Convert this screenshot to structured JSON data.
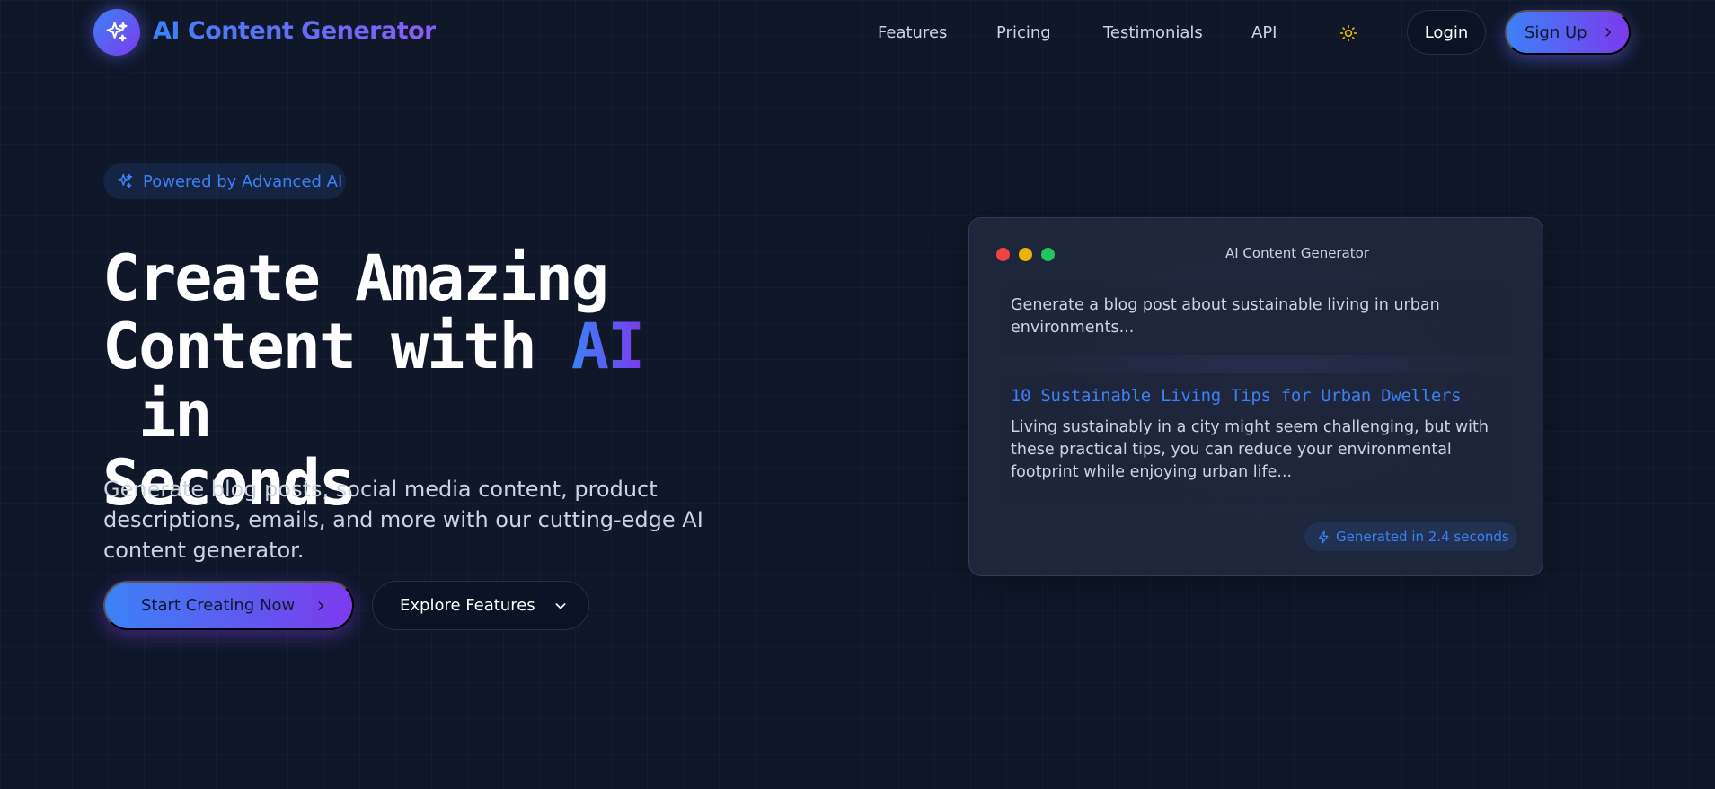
{
  "header": {
    "logo_text": "AI Content Generator",
    "nav": [
      "Features",
      "Pricing",
      "Testimonials",
      "API"
    ],
    "login_label": "Login",
    "signup_label": "Sign Up"
  },
  "hero": {
    "badge": "Powered by Advanced AI",
    "title_line1": "Create Amazing",
    "title_line2_pre": "Content with ",
    "title_accent": "AI",
    "title_line2_post": " in",
    "title_line3": "Seconds",
    "subtitle": "Generate blog posts, social media content, product descriptions, emails, and more with our cutting-edge AI content generator.",
    "cta_primary": "Start Creating Now",
    "cta_secondary": "Explore Features"
  },
  "preview": {
    "window_title": "AI Content Generator",
    "prompt": "Generate a blog post about sustainable living in urban environments...",
    "output_title": "10 Sustainable Living Tips for Urban Dwellers",
    "output_text": "Living sustainably in a city might seem challenging, but with these practical tips, you can reduce your environmental footprint while enjoying urban life...",
    "generated_label": "Generated in 2.4 seconds"
  },
  "colors": {
    "background": "#0f1729",
    "accent_blue": "#3b82f6",
    "accent_purple": "#7c3aed",
    "window_dot_red": "#ef4444",
    "window_dot_yellow": "#eab308",
    "window_dot_green": "#22c55e"
  },
  "icons": {
    "logo": "sparkles-icon",
    "theme": "sun-icon",
    "signup": "chevron-right-icon",
    "badge": "sparkles-icon",
    "cta_primary": "chevron-right-icon",
    "cta_secondary": "chevron-down-icon",
    "generated": "lightning-icon"
  }
}
